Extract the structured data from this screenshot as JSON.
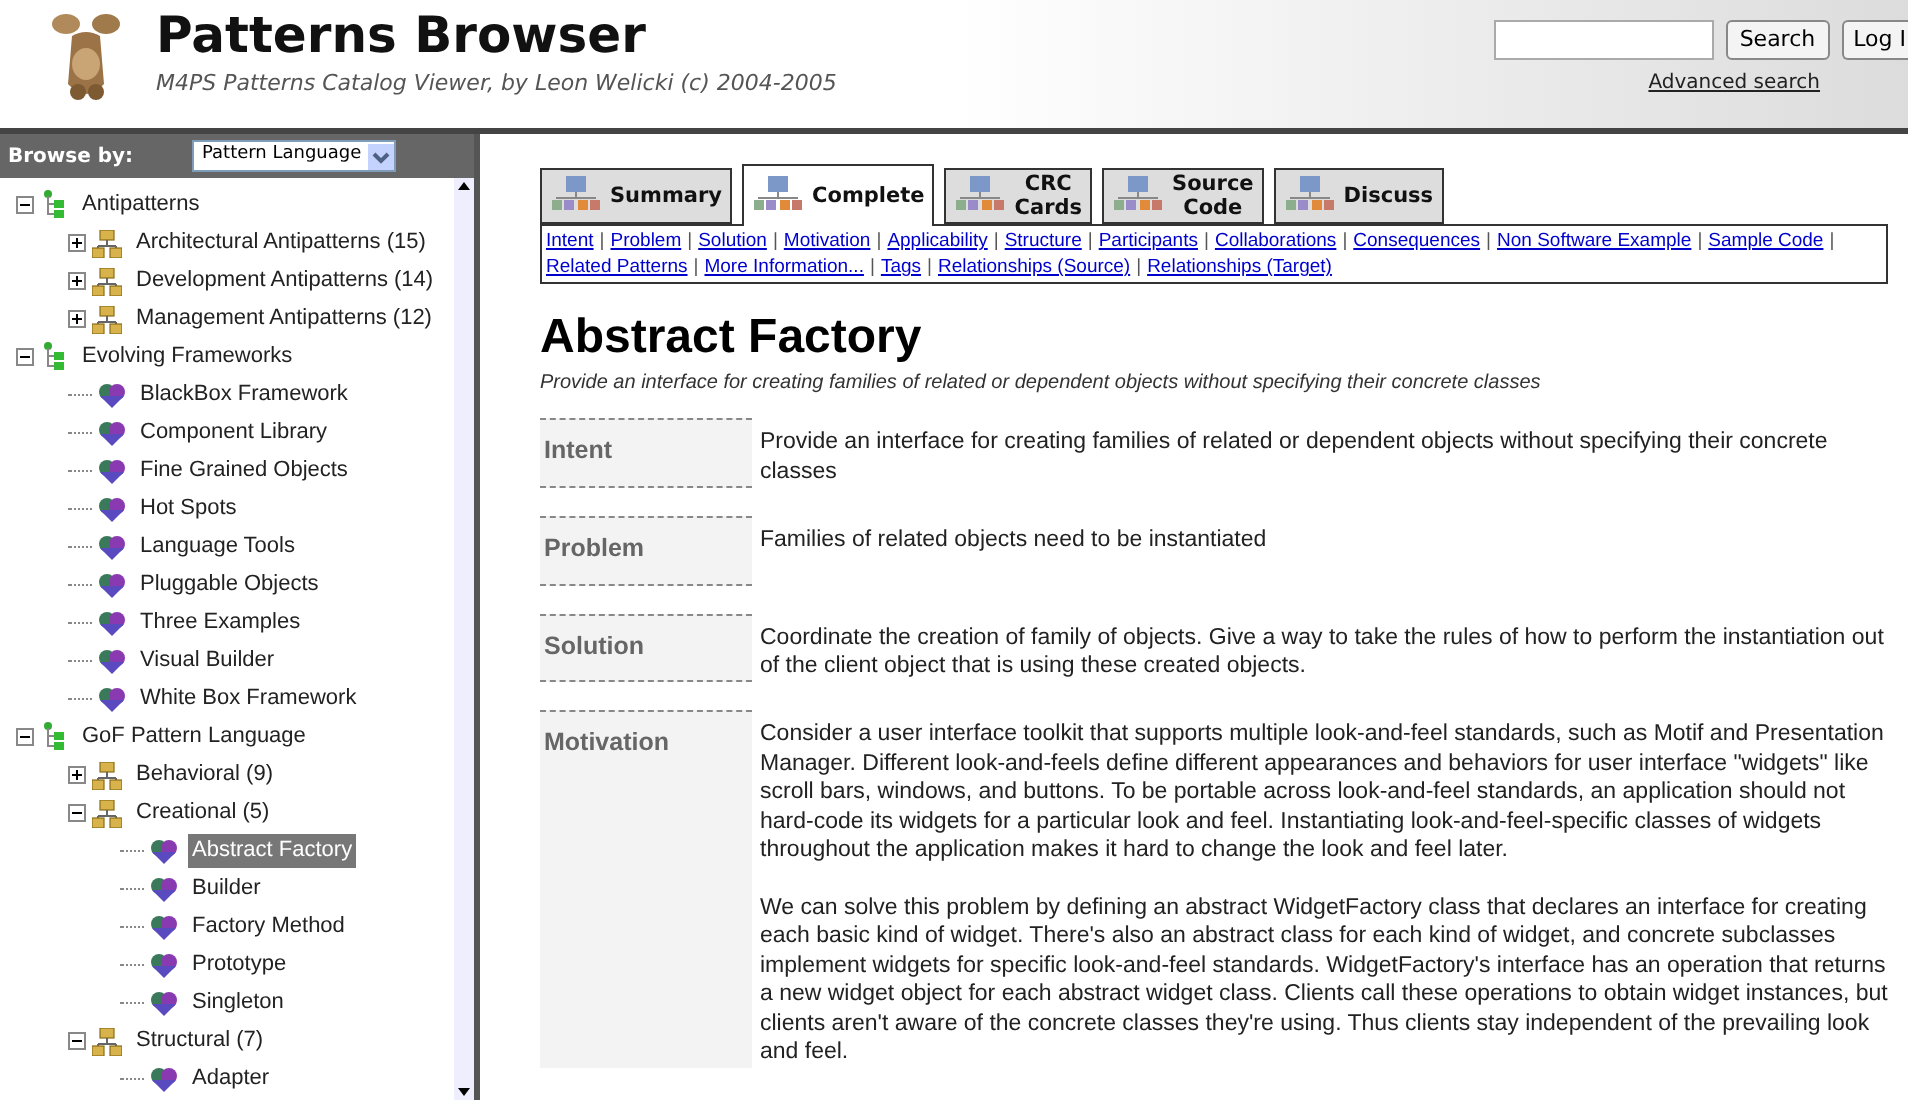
{
  "header": {
    "title": "Patterns Browser",
    "subtitle": "M4PS Patterns Catalog Viewer, by Leon Welicki (c) 2004-2005",
    "search_button": "Search",
    "login_button": "Log I",
    "advanced_link": "Advanced search"
  },
  "sidebar": {
    "browse_label": "Browse by:",
    "browse_value": "Pattern Language",
    "tree": [
      {
        "kind": "language",
        "label": "Antipatterns",
        "expanded": true,
        "children": [
          {
            "kind": "category",
            "label": "Architectural Antipatterns (15)",
            "expanded": false
          },
          {
            "kind": "category",
            "label": "Development Antipatterns (14)",
            "expanded": false
          },
          {
            "kind": "category",
            "label": "Management Antipatterns (12)",
            "expanded": false
          }
        ]
      },
      {
        "kind": "language",
        "label": "Evolving Frameworks",
        "expanded": true,
        "children": [
          {
            "kind": "pattern",
            "label": "BlackBox Framework",
            "selected": false
          },
          {
            "kind": "pattern",
            "label": "Component Library",
            "selected": false
          },
          {
            "kind": "pattern",
            "label": "Fine Grained Objects",
            "selected": false
          },
          {
            "kind": "pattern",
            "label": "Hot Spots",
            "selected": false
          },
          {
            "kind": "pattern",
            "label": "Language Tools",
            "selected": false
          },
          {
            "kind": "pattern",
            "label": "Pluggable Objects",
            "selected": false
          },
          {
            "kind": "pattern",
            "label": "Three Examples",
            "selected": false
          },
          {
            "kind": "pattern",
            "label": "Visual Builder",
            "selected": false
          },
          {
            "kind": "pattern",
            "label": "White Box Framework",
            "selected": false
          }
        ]
      },
      {
        "kind": "language",
        "label": "GoF Pattern Language",
        "expanded": true,
        "children": [
          {
            "kind": "category",
            "label": "Behavioral (9)",
            "expanded": false
          },
          {
            "kind": "category",
            "label": "Creational (5)",
            "expanded": true,
            "children": [
              {
                "kind": "pattern",
                "label": "Abstract Factory",
                "selected": true
              },
              {
                "kind": "pattern",
                "label": "Builder",
                "selected": false
              },
              {
                "kind": "pattern",
                "label": "Factory Method",
                "selected": false
              },
              {
                "kind": "pattern",
                "label": "Prototype",
                "selected": false
              },
              {
                "kind": "pattern",
                "label": "Singleton",
                "selected": false
              }
            ]
          },
          {
            "kind": "category",
            "label": "Structural (7)",
            "expanded": true,
            "children": [
              {
                "kind": "pattern",
                "label": "Adapter",
                "selected": false
              }
            ]
          }
        ]
      }
    ]
  },
  "tabs": [
    {
      "label": "Summary",
      "selected": false
    },
    {
      "label": "Complete",
      "selected": true
    },
    {
      "label": "CRC Cards",
      "selected": false
    },
    {
      "label": "Source Code",
      "selected": false
    },
    {
      "label": "Discuss",
      "selected": false
    }
  ],
  "section_links": {
    "separator": "|",
    "links": [
      "Intent",
      "Problem",
      "Solution",
      "Motivation",
      "Applicability",
      "Structure",
      "Participants",
      "Collaborations",
      "Consequences",
      "Non Software Example",
      "Sample Code",
      "Related Patterns",
      "More Information...",
      "Tags",
      "Relationships (Source)",
      "Relationships (Target)"
    ]
  },
  "pattern": {
    "title": "Abstract Factory",
    "intent_summary": "Provide an interface for creating families of related or dependent objects without specifying their concrete classes",
    "sections": [
      {
        "label": "Intent",
        "paragraphs": [
          "Provide an interface for creating families of related or dependent objects without specifying their concrete classes"
        ]
      },
      {
        "label": "Problem",
        "paragraphs": [
          "Families of related objects need to be instantiated"
        ]
      },
      {
        "label": "Solution",
        "paragraphs": [
          "Coordinate the creation of family of objects. Give a way to take the rules of how to perform the instantiation out of the client object that is using these created objects."
        ]
      },
      {
        "label": "Motivation",
        "paragraphs": [
          "Consider a user interface toolkit that supports multiple look-and-feel standards, such as Motif and Presentation Manager. Different look-and-feels define different appearances and behaviors for user interface \"widgets\" like scroll bars, windows, and buttons. To be portable across look-and-feel standards, an application should not hard-code its widgets for a particular look and feel. Instantiating look-and-feel-specific classes of widgets throughout the application makes it hard to change the look and feel later.",
          "We can solve this problem by defining an abstract WidgetFactory class that declares an interface for creating each basic kind of widget. There's also an abstract class for each kind of widget, and concrete subclasses implement widgets for specific look-and-feel standards. WidgetFactory's interface has an operation that returns a new widget object for each abstract widget class. Clients call these operations to obtain widget instances, but clients aren't aware of the concrete classes they're using. Thus clients stay independent of the prevailing look and feel."
        ]
      }
    ]
  }
}
